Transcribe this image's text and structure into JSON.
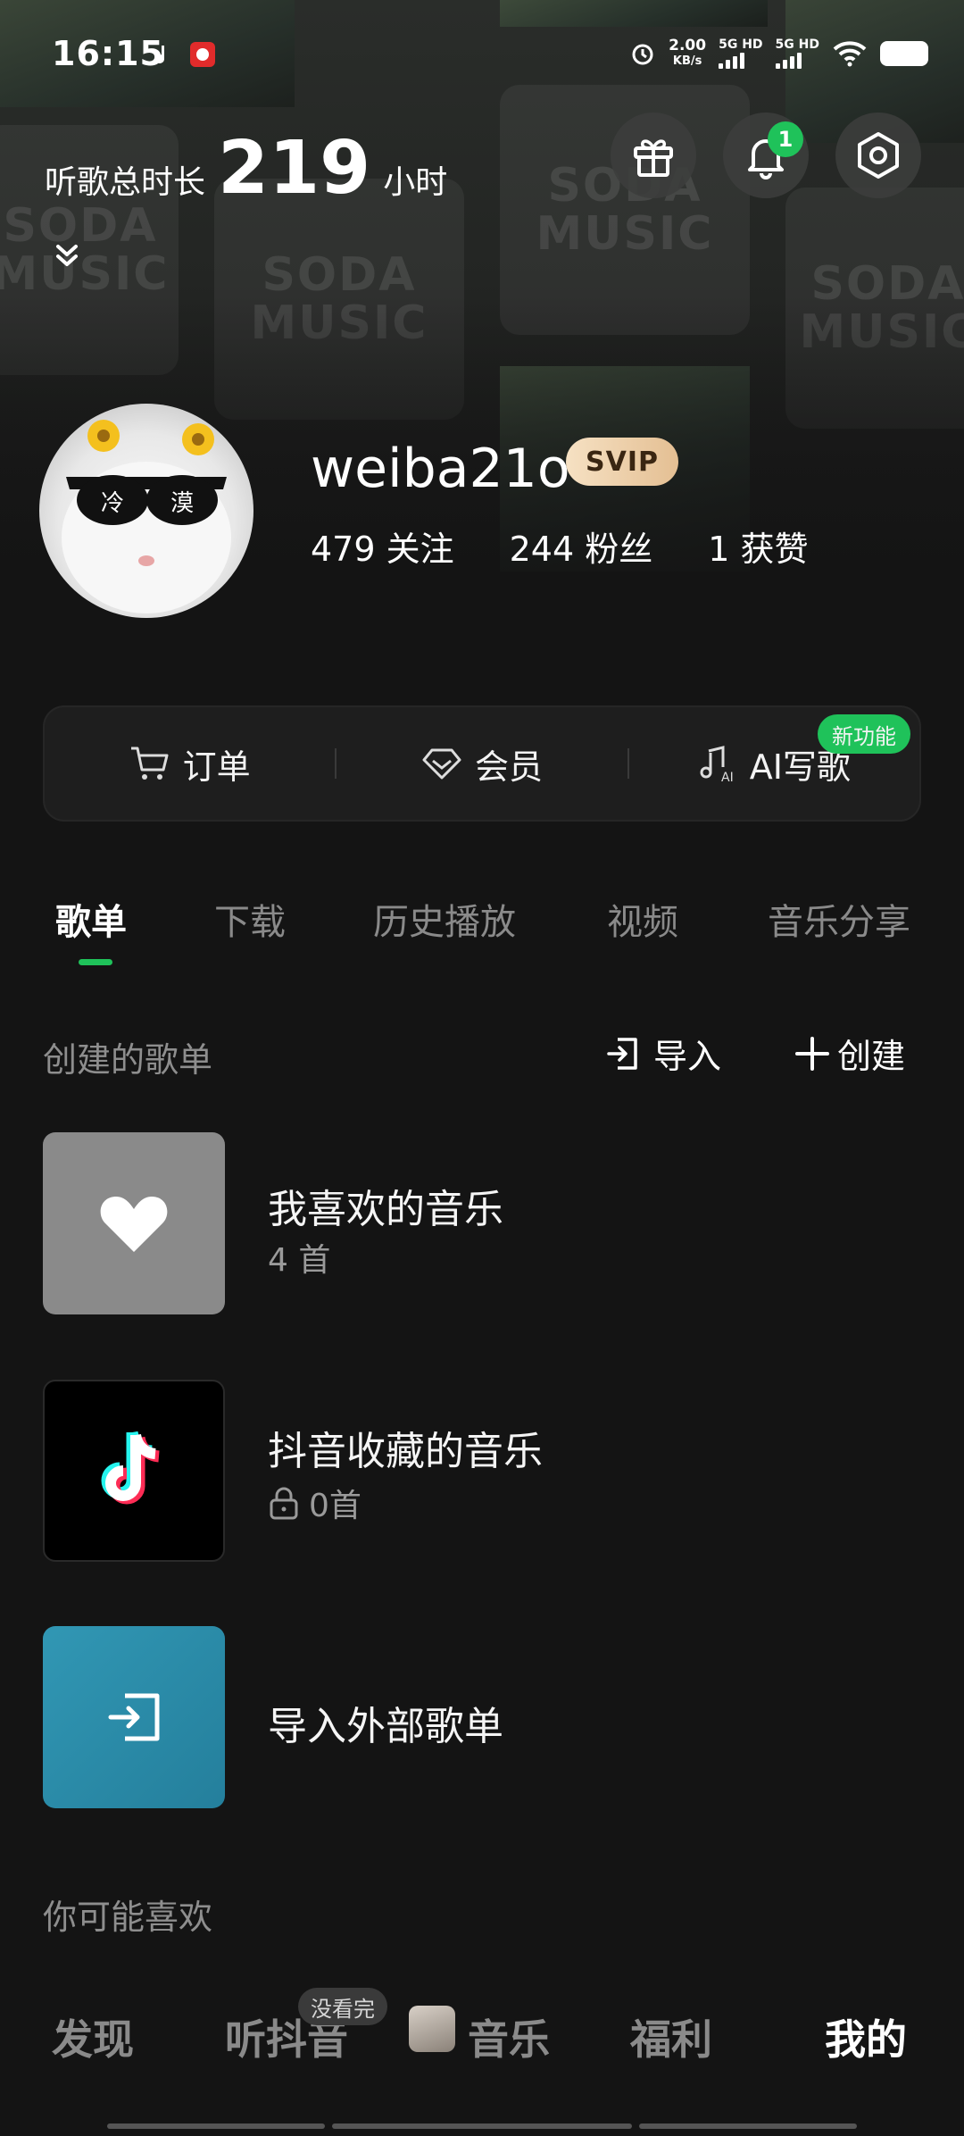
{
  "status_bar": {
    "time": "16:15",
    "speed_value": "2.00",
    "speed_unit": "KB/s",
    "net1": "5G HD",
    "net2": "5G HD"
  },
  "header": {
    "listen_label": "听歌总时长",
    "listen_value": "219",
    "listen_unit": "小时",
    "notification_count": "1"
  },
  "profile": {
    "username": "weiba21o",
    "vip_badge": "SVIP",
    "avatar_text_left": "冷",
    "avatar_text_right": "漠",
    "following": "479 关注",
    "followers": "244 粉丝",
    "likes": "1 获赞"
  },
  "quick_actions": {
    "orders": "订单",
    "membership": "会员",
    "ai_write": "AI写歌",
    "new_tag": "新功能"
  },
  "tabs": [
    "歌单",
    "下载",
    "历史播放",
    "视频",
    "音乐分享"
  ],
  "playlists_section": {
    "title": "创建的歌单",
    "import_label": "导入",
    "create_label": "创建"
  },
  "playlists": [
    {
      "title": "我喜欢的音乐",
      "subtitle": "4 首"
    },
    {
      "title": "抖音收藏的音乐",
      "subtitle": "0首"
    },
    {
      "title": "导入外部歌单"
    }
  ],
  "recommend_title": "你可能喜欢",
  "bottom_nav": {
    "discover": "发现",
    "listen_douyin": "听抖音",
    "bubble": "没看完",
    "music": "音乐",
    "welfare": "福利",
    "mine": "我的"
  },
  "colors": {
    "accent_green": "#1fc25a",
    "background": "#141414",
    "import_cover": "#2a8aa8"
  }
}
